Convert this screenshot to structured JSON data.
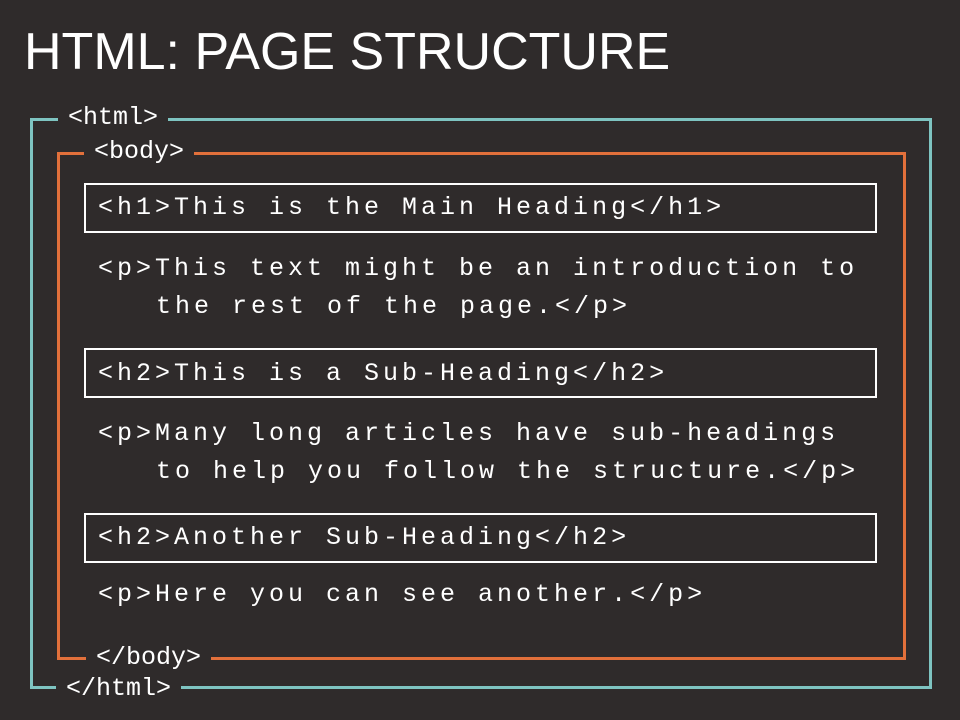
{
  "title": "HTML: PAGE STRUCTURE",
  "colors": {
    "background": "#2f2b2b",
    "html_border": "#7ec4c1",
    "body_border": "#e2703b",
    "text": "#ffffff"
  },
  "tags": {
    "html_open": "<html>",
    "html_close": "</html>",
    "body_open": "<body>",
    "body_close": "</body>"
  },
  "code_lines": {
    "h1": "<h1>This is the Main Heading</h1>",
    "p1_line1": "<p>This text might be an introduction to",
    "p1_line2": "the rest of the page.</p>",
    "h2_first": "<h2>This is a Sub-Heading</h2>",
    "p2_line1": "<p>Many long articles have sub-headings",
    "p2_line2": "to help you follow the structure.</p>",
    "h2_second": "<h2>Another Sub-Heading</h2>",
    "p3_line1": "<p>Here you can see another.</p>"
  }
}
